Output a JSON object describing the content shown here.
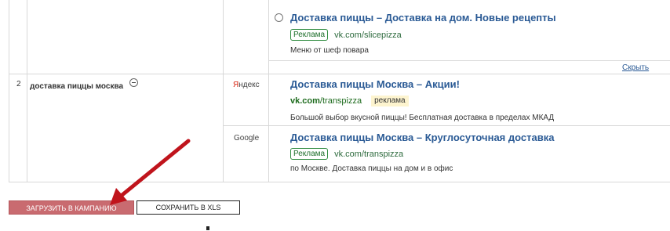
{
  "top_ad": {
    "title": "Доставка пиццы – Доставка на дом. Новые рецепты",
    "badge": "Реклама",
    "url": "vk.com/slicepizza",
    "description": "Меню от шеф повара"
  },
  "hide_link": "Скрыть",
  "row": {
    "number": "2",
    "keyword": "доставка пиццы москва",
    "yandex": {
      "engine": "Яндекс",
      "title": "Доставка пиццы Москва – Акции!",
      "url_domain": "vk.com",
      "url_path": "/transpizza",
      "badge": "реклама",
      "description": "Большой выбор вкусной пиццы! Бесплатная доставка в пределах МКАД"
    },
    "google": {
      "engine": "Google",
      "title": "Доставка пиццы Москва – Круглосуточная доставка",
      "badge": "Реклама",
      "url": "vk.com/transpizza",
      "description": "по Москве. Доставка пиццы на дом и в офис"
    }
  },
  "buttons": {
    "upload": "ЗАГРУЗИТЬ В КАМПАНИЮ",
    "save": "СОХРАНИТЬ В XLS"
  },
  "colors": {
    "link": "#2a5a95",
    "upload_button": "#c96b70",
    "arrow": "#c0141c"
  }
}
